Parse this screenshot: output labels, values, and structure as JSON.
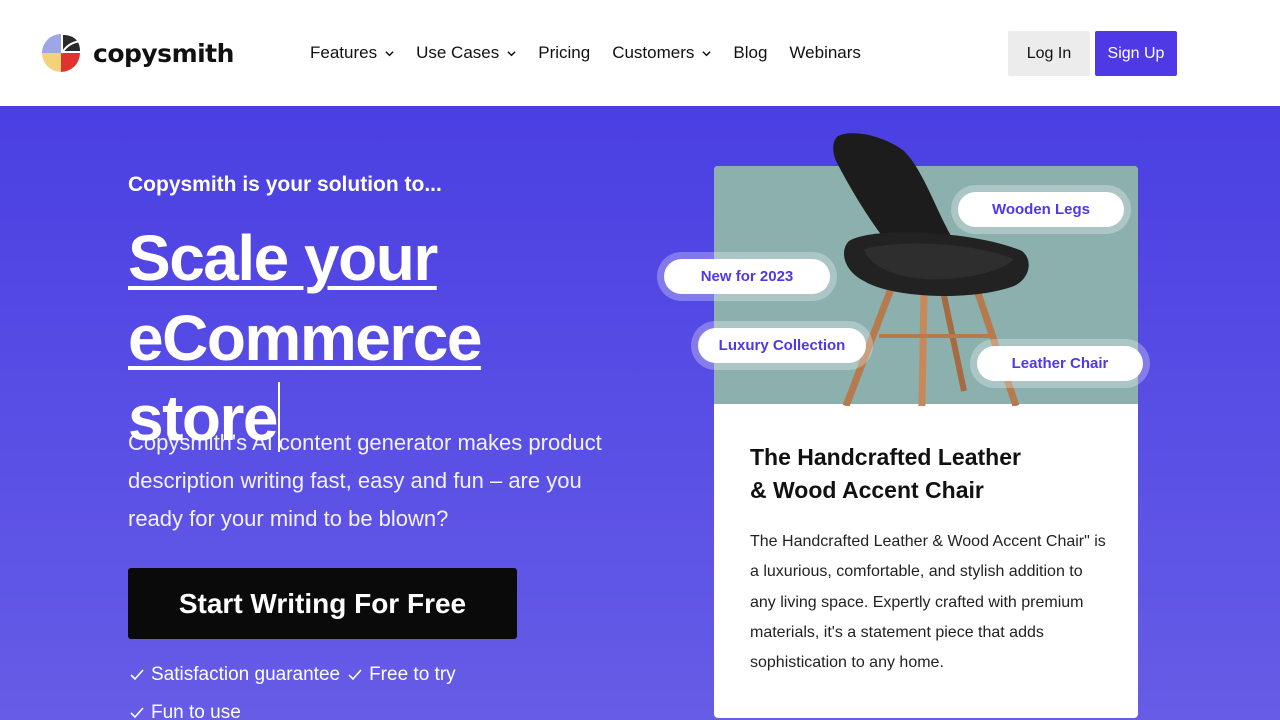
{
  "brand": {
    "name": "copysmith"
  },
  "nav": {
    "items": [
      {
        "label": "Features",
        "has_dropdown": true
      },
      {
        "label": "Use Cases",
        "has_dropdown": true
      },
      {
        "label": "Pricing",
        "has_dropdown": false
      },
      {
        "label": "Customers",
        "has_dropdown": true
      },
      {
        "label": "Blog",
        "has_dropdown": false
      },
      {
        "label": "Webinars",
        "has_dropdown": false
      }
    ],
    "login_label": "Log In",
    "signup_label": "Sign Up"
  },
  "hero": {
    "eyebrow": "Copysmith is your solution to...",
    "headline_line1": "Scale your",
    "headline_line2": "eCommerce",
    "headline_line3": "store",
    "subtext": "Copysmith's AI content generator makes product description writing fast, easy and fun – are you ready for your mind to be blown?",
    "cta_label": "Start Writing For Free",
    "checks": [
      "Satisfaction guarantee",
      "Free to try",
      "Fun to use"
    ]
  },
  "product_card": {
    "tags": [
      "Wooden Legs",
      "New for 2023",
      "Luxury Collection",
      "Leather Chair"
    ],
    "title_line1": "The Handcrafted Leather",
    "title_line2": "& Wood Accent Chair",
    "description": "The Handcrafted Leather & Wood Accent Chair\" is a luxurious, comfortable, and stylish addition to any living space. Expertly crafted with premium materials, it's a statement piece that adds sophistication to any home."
  },
  "colors": {
    "accent": "#4f39e6",
    "hero_top": "#4a3fe2",
    "hero_bottom": "#665ce6",
    "image_bg": "#8bb0ad",
    "cta_bg": "#0a0a0a"
  },
  "icons": [
    "copysmith-logo-icon",
    "chevron-down-icon",
    "check-icon",
    "chair-image"
  ]
}
